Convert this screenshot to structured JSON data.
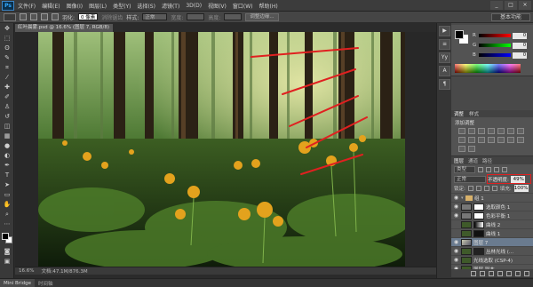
{
  "app": {
    "logo": "Ps"
  },
  "menu": [
    "文件(F)",
    "编辑(E)",
    "图像(I)",
    "图层(L)",
    "类型(Y)",
    "选择(S)",
    "滤镜(T)",
    "3D(D)",
    "视图(V)",
    "窗口(W)",
    "帮助(H)"
  ],
  "window_controls": [
    "_",
    "□",
    "×"
  ],
  "options": {
    "feather_label": "羽化:",
    "feather_value": "0 像素",
    "antialias_label": "消除锯齿",
    "style_label": "样式:",
    "style_value": "正常",
    "width_label": "宽度:",
    "height_label": "高度:",
    "refine_button": "调整边缘...",
    "workspace": "基本功能"
  },
  "document": {
    "tab_title": "红叶晨雾.psd @ 16.6% (图层 7, RGB/8)",
    "close": "×"
  },
  "status": {
    "zoom": "16.6%",
    "doc_info": "文档:47.1M/876.3M"
  },
  "bottom_tabs": [
    "Mini Bridge",
    "时间轴"
  ],
  "strip_icons": [
    "▶",
    "≡",
    "Yy",
    "A",
    "¶"
  ],
  "color_panel": {
    "r_label": "R",
    "g_label": "G",
    "b_label": "B",
    "r_value": "0",
    "g_value": "0",
    "b_value": "0"
  },
  "adjustments": {
    "tabs": [
      "调整",
      "样式"
    ],
    "title": "添加调整"
  },
  "layers": {
    "tabs": [
      "图层",
      "通道",
      "路径"
    ],
    "kind": "类型",
    "blend_mode": "正常",
    "opacity_label": "不透明度:",
    "opacity_value": "49%",
    "lock_label": "锁定:",
    "fill_label": "填充:",
    "fill_value": "100%",
    "rows": [
      {
        "name": "组 1",
        "visible": true
      },
      {
        "name": "选取颜色 1",
        "visible": true
      },
      {
        "name": "色彩平衡 1",
        "visible": true
      },
      {
        "name": "曲线 2",
        "visible": false
      },
      {
        "name": "曲线 1",
        "visible": false
      },
      {
        "name": "图层 7",
        "visible": true
      },
      {
        "name": "丛林光线 (...",
        "visible": true
      },
      {
        "name": "光线选取 (CSP-4)",
        "visible": true
      },
      {
        "name": "图层 副本",
        "visible": true
      },
      {
        "name": "图层",
        "visible": true
      }
    ]
  },
  "colors": {
    "annotation_red": "#e02020",
    "selected_layer": "#6a7b8f"
  }
}
